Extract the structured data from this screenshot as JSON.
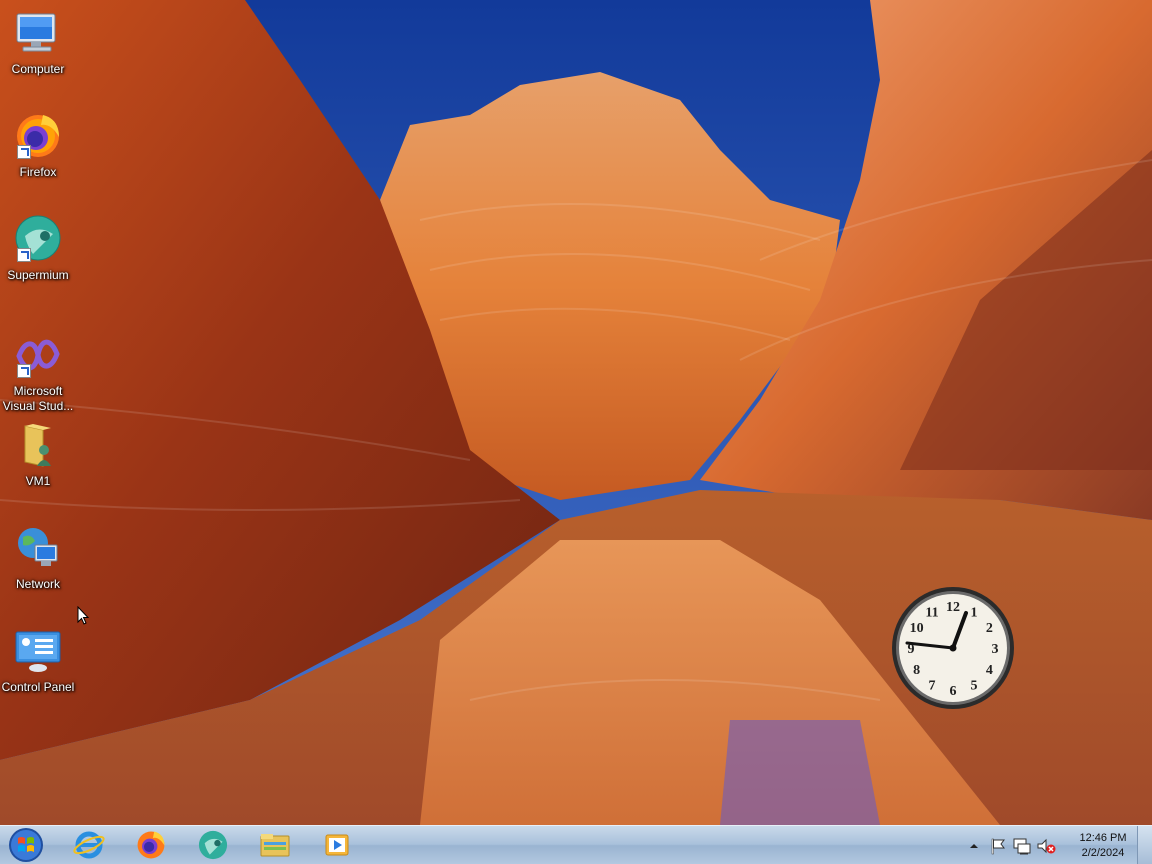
{
  "desktop": {
    "icons": [
      {
        "label": "Computer",
        "icon": "computer-icon",
        "shortcut": false
      },
      {
        "label": "Firefox",
        "icon": "firefox-icon",
        "shortcut": true
      },
      {
        "label": "Supermium",
        "icon": "supermium-icon",
        "shortcut": true
      },
      {
        "label": "Microsoft Visual Stud...",
        "icon": "visual-studio-icon",
        "shortcut": true
      },
      {
        "label": "VM1",
        "icon": "user-folder-icon",
        "shortcut": false
      },
      {
        "label": "Network",
        "icon": "network-icon",
        "shortcut": false
      },
      {
        "label": "Control Panel",
        "icon": "control-panel-icon",
        "shortcut": false
      }
    ]
  },
  "clock_gadget": {
    "numerals": [
      "12",
      "1",
      "2",
      "3",
      "4",
      "5",
      "6",
      "7",
      "8",
      "9",
      "10",
      "11"
    ]
  },
  "taskbar": {
    "start_icon": "windows-start-orb-icon",
    "pinned": [
      {
        "name": "Internet Explorer",
        "icon": "internet-explorer-icon"
      },
      {
        "name": "Firefox",
        "icon": "firefox-icon"
      },
      {
        "name": "Supermium",
        "icon": "supermium-icon"
      },
      {
        "name": "Windows Explorer",
        "icon": "file-explorer-icon"
      },
      {
        "name": "Windows Media Player",
        "icon": "media-player-icon"
      }
    ],
    "tray": {
      "icons": [
        "show-hidden-icons-arrow-icon",
        "action-center-flag-icon",
        "network-status-icon",
        "volume-muted-icon"
      ],
      "time": "12:46 PM",
      "date": "2/2/2024"
    }
  },
  "colors": {
    "sky": "#2f5fbf",
    "rock_orange": "#e0702a",
    "rock_dark": "#7a2a14",
    "taskbar": "#b2c8e0"
  }
}
